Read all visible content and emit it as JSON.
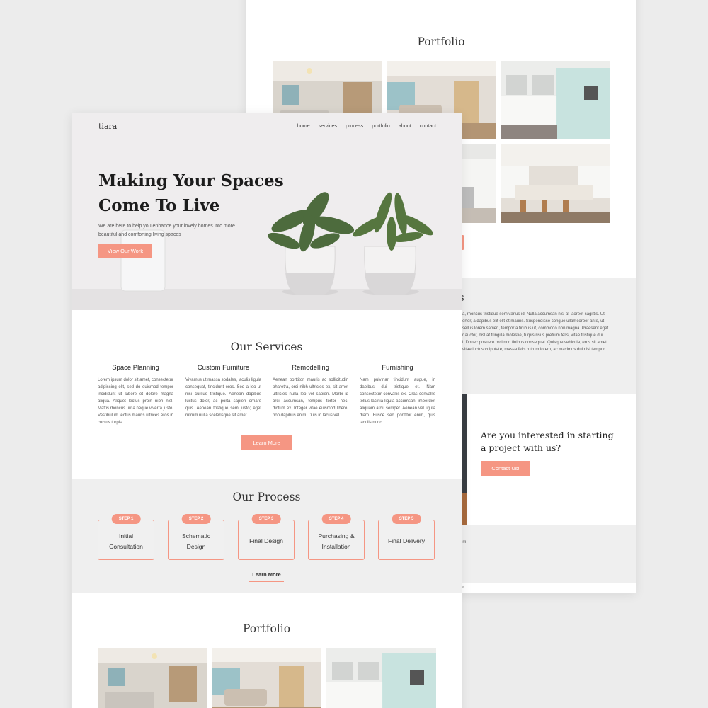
{
  "colors": {
    "accent": "#f59683",
    "bg": "#ececec",
    "section_gray": "#efefef"
  },
  "back_page": {
    "portfolio_title": "Portfolio",
    "about_title_fragment": "s",
    "about_lines": [
      "a, rhoncus tristique sem varius id. Nulla accumsan nisl at laoreet sagittis. Ut",
      "ortor, a dapibus elit elit et mauris. Suspendisse congue ullamcorper ante, ut",
      "sellus lorem sapien, tempor a finibus ut, commodo non magna. Praesent eget",
      "r auctor, nisl at fringilla molestie, turpis risus pretium felis, vitae tristique dui",
      "i. Donec posuere orci non finibus consequat. Quisque vehicula, eros sit amet",
      "vitae luctus vulputate, massa felis rutrum lorem, ac maximus dui nisl tempor"
    ],
    "cta_heading_1": "Are you interested in starting",
    "cta_heading_2": "a project with us?",
    "cta_button": "Contact Us!",
    "footer_fragment_1": "om",
    "footer_fragment_2": "za"
  },
  "front_page": {
    "logo": "tiara",
    "nav": [
      "home",
      "services",
      "process",
      "portfolio",
      "about",
      "contact"
    ],
    "hero": {
      "title_1": "Making Your Spaces",
      "title_2": "Come To Live",
      "subtitle_1": "We are here to help you enhance your lovely homes into more",
      "subtitle_2": "beautiful and comforting living spaces",
      "button": "View Our Work"
    },
    "services": {
      "title": "Our Services",
      "items": [
        {
          "name": "Space Planning",
          "text": "Lorem ipsum dolor sit amet, consectetur adipiscing elit, sed do euismod tempor incididunt ut labore et dolore magna aliqua. Aliquet lectus proin nibh nisl. Mattis rhoncus urna neque viverra justo. Vestibulum lectus mauris ultrices eros in cursus turpis."
        },
        {
          "name": "Custom Furniture",
          "text": "Vivamus ut massa sodales, iaculis ligula consequat, tincidunt eros. Sed a leo ut nisi cursus tristique. Aenean dapibus luctus dolor, ac porta sapien ornare quis. Aenean tristique sem justo; eget rutrum nulla scelerisque sit amet."
        },
        {
          "name": "Remodelling",
          "text": "Aenean porttitor, mauris ac sollicitudin pharetra, orci nibh ultricies ex, sit amet ultricies nulla leo vel sapien. Morbi id orci accumsan, tempus tortor nec, dictum ex. Integer vitae euismod libero, non dapibus enim. Duis id lacus vel."
        },
        {
          "name": "Furnishing",
          "text": "Nam pulvinar tincidunt augue, in dapibus dui tristique et. Nam consectetur convallis ex. Cras convallis tellus lacinia ligula accumsan, imperdiet aliquam arcu semper. Aenean vel ligula diam. Fusce sed porttitor enim, quis iaculis nunc."
        }
      ],
      "button": "Learn More"
    },
    "process": {
      "title": "Our Process",
      "steps": [
        {
          "badge": "STEP 1",
          "label": "Initial Consultation"
        },
        {
          "badge": "STEP 2",
          "label": "Schematic Design"
        },
        {
          "badge": "STEP 3",
          "label": "Final Design"
        },
        {
          "badge": "STEP 4",
          "label": "Purchasing & Installation"
        },
        {
          "badge": "STEP 5",
          "label": "Final Delivery"
        }
      ],
      "link": "Learn More"
    },
    "portfolio_title": "Portfolio"
  }
}
